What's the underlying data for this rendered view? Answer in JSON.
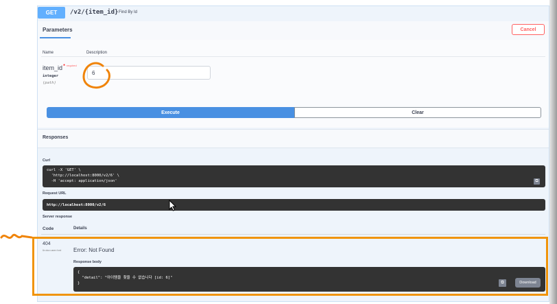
{
  "operation": {
    "method": "GET",
    "path": "/v2/{item_id}",
    "summary": "Find By Id"
  },
  "params_tab": {
    "label": "Parameters"
  },
  "cancel_label": "Cancel",
  "table_headers": {
    "name": "Name",
    "description": "Description"
  },
  "parameter": {
    "name": "item_id",
    "required_star": "*",
    "required_text": "required",
    "type": "integer",
    "in": "(path)",
    "value": "6"
  },
  "buttons": {
    "execute": "Execute",
    "clear": "Clear"
  },
  "responses": {
    "title": "Responses",
    "curl_label": "Curl",
    "curl_command": "curl -X 'GET' \\\n  'http://localhost:8000/v2/6' \\\n  -H 'accept: application/json'",
    "request_url_label": "Request URL",
    "request_url": "http://localhost:8000/v2/6",
    "server_response_label": "Server response",
    "code_header": "Code",
    "details_header": "Details",
    "status_code": "404",
    "status_note": "Undocumented",
    "error_text": "Error: Not Found",
    "response_body_label": "Response body",
    "response_body": "{\n  \"detail\": \"아이템을 찾을 수 없습니다 [id: 6]\"\n}",
    "download_label": "Download"
  },
  "colors": {
    "get_badge": "#61affe",
    "execute": "#4990e2",
    "cancel": "#ff6060",
    "highlight": "#f0940a",
    "code_bg": "#333333"
  },
  "icons": [
    "copy-icon",
    "mouse-cursor-icon",
    "circle-annotation",
    "squiggle-arrow-annotation"
  ]
}
